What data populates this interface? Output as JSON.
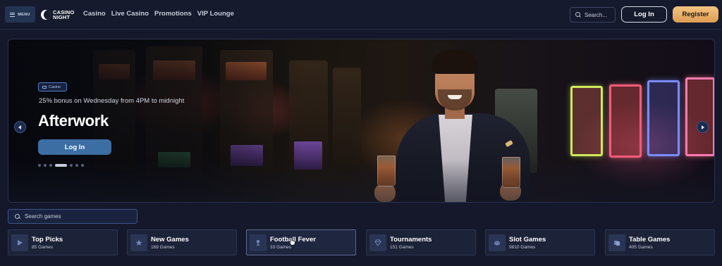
{
  "header": {
    "menu_label": "MENU",
    "logo_line1": "CASINO",
    "logo_line2": "NIGHT",
    "nav": [
      "Casino",
      "Live Casino",
      "Promotions",
      "VIP Lounge"
    ],
    "search_placeholder": "Search...",
    "login_label": "Log In",
    "register_label": "Register"
  },
  "hero": {
    "tag": "Casino",
    "subtitle": "25% bonus on Wednesday from 4PM to midnight",
    "title": "Afterwork",
    "button_label": "Log In",
    "slide_count": 8,
    "active_slide": 4
  },
  "games_search": {
    "placeholder": "Search games"
  },
  "categories": [
    {
      "name": "Top Picks",
      "count": "85 Games",
      "icon": "play-icon"
    },
    {
      "name": "New Games",
      "count": "169 Games",
      "icon": "star-icon"
    },
    {
      "name": "Football Fever",
      "count": "33 Games",
      "icon": "trophy-icon"
    },
    {
      "name": "Tournaments",
      "count": "151 Games",
      "icon": "diamond-icon"
    },
    {
      "name": "Slot Games",
      "count": "9810 Games",
      "icon": "slot-icon"
    },
    {
      "name": "Table Games",
      "count": "405 Games",
      "icon": "cards-icon"
    }
  ],
  "colors": {
    "background": "#14182a",
    "accent_gold": "#f0bd7a",
    "accent_blue": "#3c6ea3"
  }
}
